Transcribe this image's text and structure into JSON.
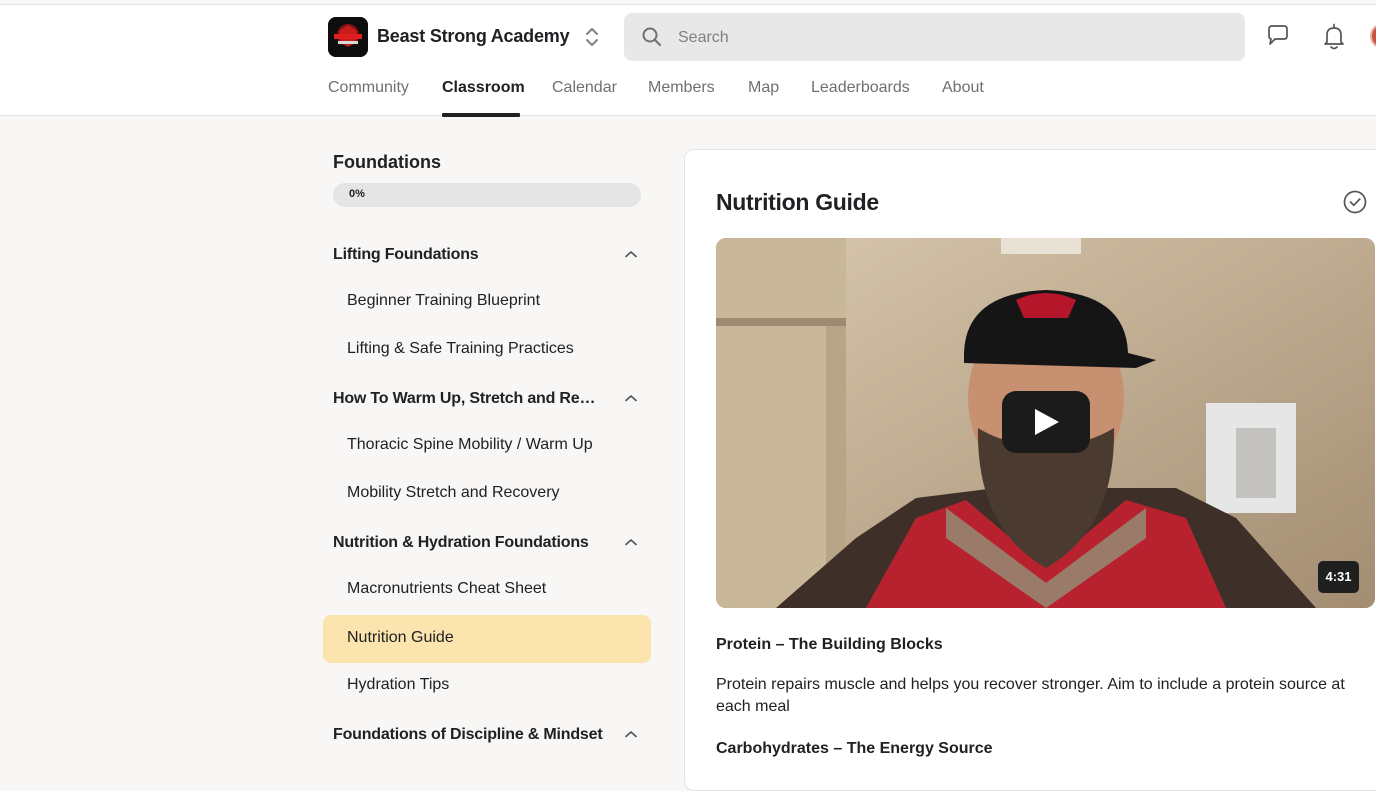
{
  "header": {
    "group_name": "Beast Strong Academy",
    "search_placeholder": "Search"
  },
  "tabs": [
    {
      "label": "Community",
      "active": false
    },
    {
      "label": "Classroom",
      "active": true
    },
    {
      "label": "Calendar",
      "active": false
    },
    {
      "label": "Members",
      "active": false
    },
    {
      "label": "Map",
      "active": false
    },
    {
      "label": "Leaderboards",
      "active": false
    },
    {
      "label": "About",
      "active": false
    }
  ],
  "course": {
    "title": "Foundations",
    "progress_label": "0%",
    "progress_fraction": 0,
    "sections": [
      {
        "title": "Lifting Foundations",
        "lessons": [
          "Beginner Training Blueprint",
          "Lifting & Safe Training Practices"
        ]
      },
      {
        "title": "How To Warm Up, Stretch and Reco...",
        "lessons": [
          "Thoracic Spine Mobility / Warm Up",
          "Mobility Stretch and Recovery"
        ]
      },
      {
        "title": "Nutrition & Hydration Foundations",
        "lessons": [
          "Macronutrients Cheat Sheet",
          "Nutrition Guide",
          "Hydration Tips"
        ]
      },
      {
        "title": "Foundations of Discipline & Mindset",
        "lessons": []
      }
    ],
    "active_lesson": "Nutrition Guide"
  },
  "lesson": {
    "title": "Nutrition Guide",
    "video_duration": "4:31",
    "blocks": [
      {
        "type": "heading",
        "text": "Protein – The Building Blocks"
      },
      {
        "type": "paragraph",
        "text": "Protein repairs muscle and helps you recover stronger. Aim to include a protein source at each meal"
      },
      {
        "type": "heading",
        "text": "Carbohydrates – The Energy Source"
      }
    ]
  },
  "colors": {
    "active_lesson_bg": "#fbe4ad",
    "page_bg": "#f8f7f5"
  }
}
